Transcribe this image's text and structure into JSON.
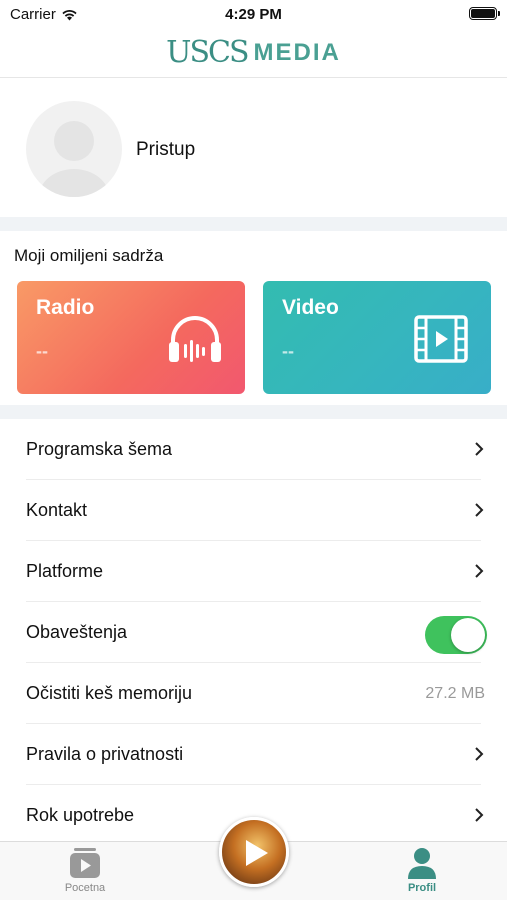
{
  "status_bar": {
    "carrier": "Carrier",
    "time": "4:29 PM"
  },
  "header": {
    "logo_mark": "USCS",
    "logo_text": "MEDIA"
  },
  "profile": {
    "name": "Pristup"
  },
  "favorites": {
    "title": "Moji omiljeni sadrža",
    "cards": [
      {
        "title": "Radio",
        "subtitle": "--",
        "icon": "headphones-icon",
        "color": "#f4695e"
      },
      {
        "title": "Video",
        "subtitle": "--",
        "icon": "film-icon",
        "color": "#36b5bf"
      }
    ]
  },
  "settings": {
    "items": [
      {
        "label": "Programska šema"
      },
      {
        "label": "Kontakt"
      },
      {
        "label": "Platforme"
      },
      {
        "label": "Obaveštenja",
        "toggle_on": true
      },
      {
        "label": "Očistiti keš memoriju",
        "value": "27.2 MB"
      },
      {
        "label": "Pravila o privatnosti"
      },
      {
        "label": "Rok upotrebe"
      }
    ]
  },
  "tabbar": {
    "home_label": "Pocetna",
    "profile_label": "Profil",
    "accent": "#3b8e84"
  }
}
